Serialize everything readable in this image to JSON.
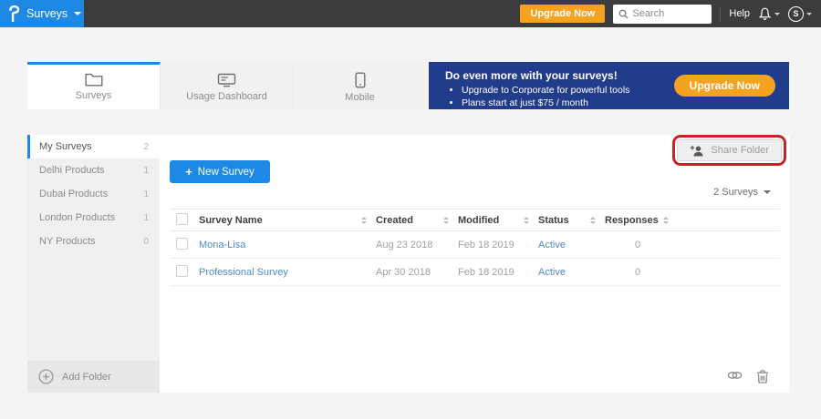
{
  "topbar": {
    "product_menu": "Surveys",
    "upgrade_button": "Upgrade Now",
    "search_placeholder": "Search",
    "help_label": "Help",
    "avatar_initial": "S"
  },
  "tabs": [
    {
      "label": "Surveys",
      "icon": "folder-icon",
      "active": true
    },
    {
      "label": "Usage Dashboard",
      "icon": "dashboard-icon",
      "active": false
    },
    {
      "label": "Mobile",
      "icon": "mobile-icon",
      "active": false
    }
  ],
  "banner": {
    "title": "Do even more with your surveys!",
    "bullets": [
      "Upgrade to Corporate for powerful tools",
      "Plans start at just $75 / month"
    ],
    "cta": "Upgrade Now"
  },
  "sidebar": {
    "items": [
      {
        "label": "My Surveys",
        "count": "2",
        "active": true
      },
      {
        "label": "Delhi Products",
        "count": "1",
        "active": false
      },
      {
        "label": "Dubai Products",
        "count": "1",
        "active": false
      },
      {
        "label": "London Products",
        "count": "1",
        "active": false
      },
      {
        "label": "NY Products",
        "count": "0",
        "active": false
      }
    ],
    "add_folder_label": "Add Folder"
  },
  "main": {
    "share_folder_label": "Share Folder",
    "new_survey_plus": "+",
    "new_survey_label": "New Survey",
    "count_dropdown": "2 Surveys",
    "table": {
      "columns": [
        "Survey Name",
        "Created",
        "Modified",
        "Status",
        "Responses"
      ],
      "rows": [
        {
          "name": "Mona-Lisa",
          "created": "Aug 23 2018",
          "modified": "Feb 18 2019",
          "status": "Active",
          "responses": "0"
        },
        {
          "name": "Professional Survey",
          "created": "Apr 30 2018",
          "modified": "Feb 18 2019",
          "status": "Active",
          "responses": "0"
        }
      ]
    }
  },
  "colors": {
    "brand_blue": "#1e88e5",
    "accent_orange": "#f6a221",
    "banner_navy": "#223c8c",
    "link_blue": "#5089c7",
    "annotation_red": "#cd2026",
    "topbar_gray": "#3c3c3c"
  }
}
